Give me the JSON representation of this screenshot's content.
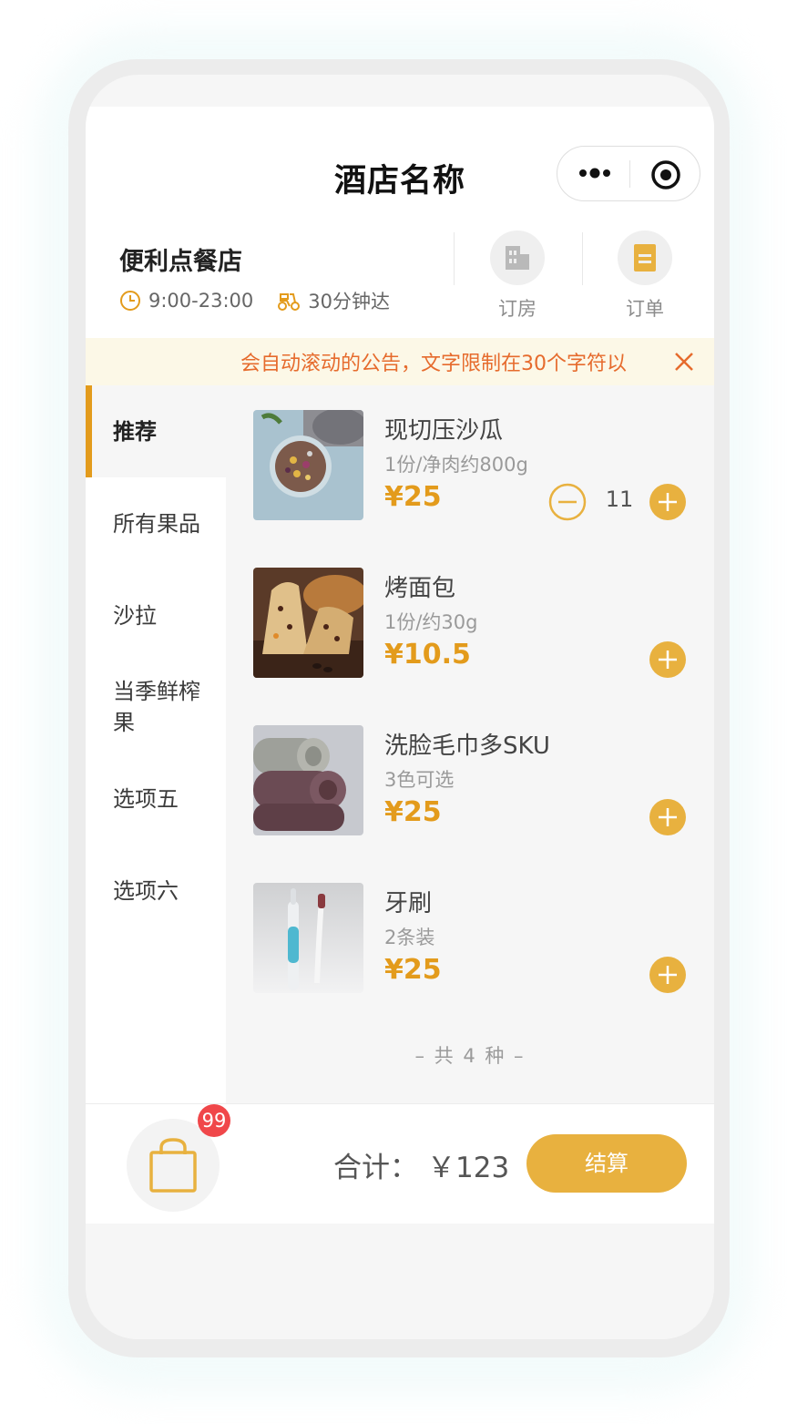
{
  "header": {
    "title": "酒店名称"
  },
  "store": {
    "name": "便利点餐店",
    "hours": "9:00-23:00",
    "delivery": "30分钟达",
    "actions": [
      {
        "label": "订房",
        "icon": "building-icon"
      },
      {
        "label": "订单",
        "icon": "order-icon"
      }
    ]
  },
  "notice": {
    "text": "会自动滚动的公告，文字限制在30个字符以"
  },
  "sidebar": {
    "items": [
      {
        "label": "推荐",
        "active": true
      },
      {
        "label": "所有果品"
      },
      {
        "label": "沙拉"
      },
      {
        "label": "当季鲜榨果"
      },
      {
        "label": "选项五"
      },
      {
        "label": "选项六"
      }
    ]
  },
  "products": [
    {
      "name": "现切压沙瓜",
      "desc": "1份/净肉约800g",
      "price": "¥25",
      "quantity": "11"
    },
    {
      "name": "烤面包",
      "desc": "1份/约30g",
      "price": "¥10.5"
    },
    {
      "name": "洗脸毛巾多SKU",
      "desc": "3色可选",
      "price": "¥25"
    },
    {
      "name": "牙刷",
      "desc": "2条装",
      "price": "¥25"
    }
  ],
  "list_footer": "– 共 4 种 –",
  "cart": {
    "badge": "99",
    "total_label": "合计：",
    "total_value": "￥123",
    "checkout_label": "结算"
  },
  "colors": {
    "accent": "#e39b1c",
    "button": "#e8b13f",
    "notice_text": "#e66b2d",
    "badge": "#f0474a"
  }
}
